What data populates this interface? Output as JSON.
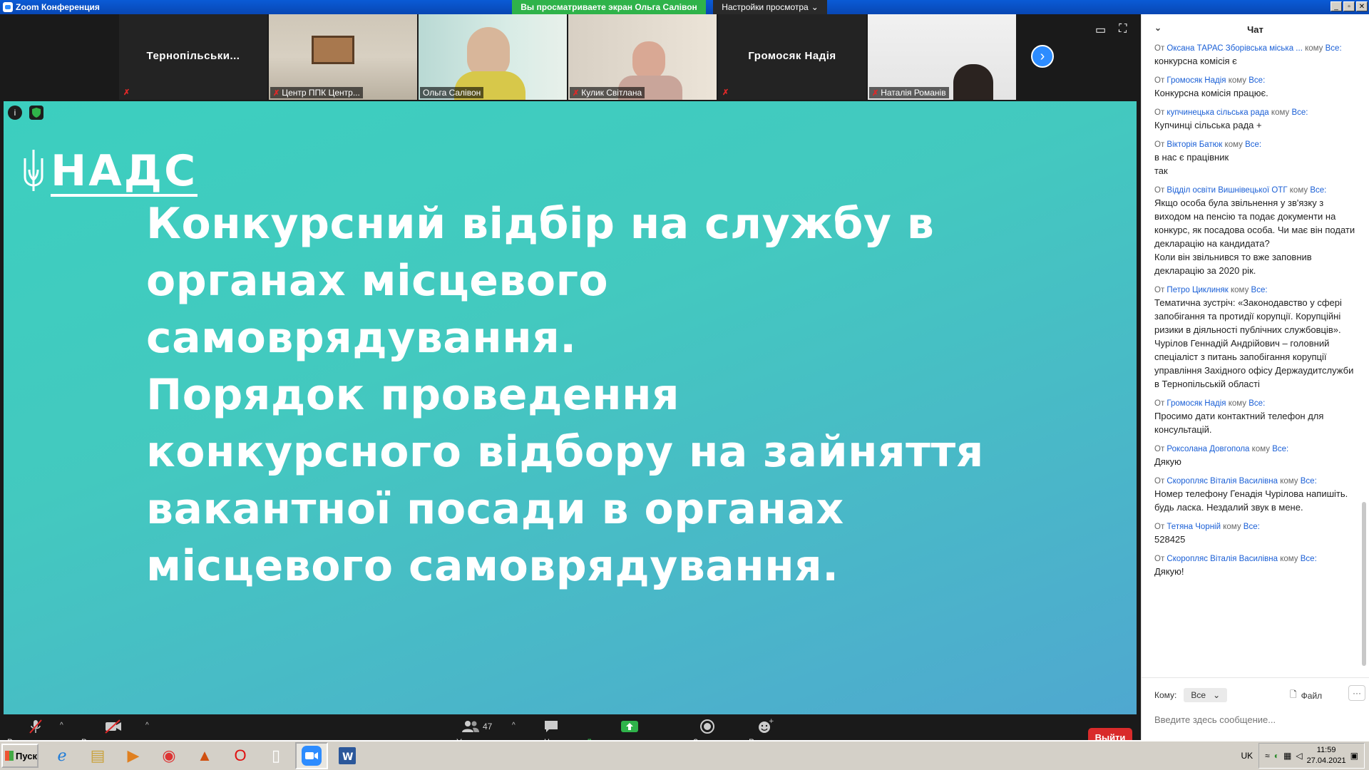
{
  "window": {
    "title": "Zoom Конференция",
    "banner": "Вы просматриваете экран Ольга Салівон",
    "view_options": "Настройки просмотра"
  },
  "participants": [
    {
      "name": "Тернопільськи...",
      "type": "name-only",
      "muted": true
    },
    {
      "name": "Центр ППК Центр...",
      "type": "video",
      "muted": true
    },
    {
      "name": "Ольга Салівон",
      "type": "video",
      "muted": false,
      "active": true
    },
    {
      "name": "Кулик Світлана",
      "type": "video",
      "muted": true
    },
    {
      "name": "Громосяк Надія",
      "type": "name-only",
      "muted": true
    },
    {
      "name": "Наталія Романів",
      "type": "video",
      "muted": true
    }
  ],
  "slide": {
    "logo_text": "НАДС",
    "title": "Конкурсний відбір на службу в органах місцевого самоврядування.\nПорядок проведення конкурсного відбору на зайняття  вакантної посади в органах місцевого самоврядування."
  },
  "toolbar": {
    "audio": "Включить звук",
    "video": "Включить видео",
    "participants": "Участники",
    "participants_count": "47",
    "chat": "Чат",
    "share": "Демонстрация экрана",
    "record": "Запись",
    "reactions": "Реакции",
    "leave": "Выйти"
  },
  "chat": {
    "title": "Чат",
    "messages": [
      {
        "prefix": "От",
        "from": "Оксана ТАРАС Зборівська міська ...",
        "to_word": "кому",
        "to": "Все:",
        "text": "конкурсна комісія є"
      },
      {
        "prefix": "От",
        "from": "Громосяк Надія",
        "to_word": "кому",
        "to": "Все:",
        "text": "Конкурсна комісія працює."
      },
      {
        "prefix": "От",
        "from": "купчинецька сільська рада",
        "to_word": "кому",
        "to": "Все:",
        "text": "Купчинці сільська рада +"
      },
      {
        "prefix": "От",
        "from": "Вікторія Батюк",
        "to_word": "кому",
        "to": "Все:",
        "text": "в нас є працівник\nтак"
      },
      {
        "prefix": "От",
        "from": "Відділ  освіти Вишнівецької ОТГ",
        "to_word": "кому",
        "to": "Все:",
        "text": "Якщо особа була звільнення у зв'язку з виходом на пенсію та подає документи на конкурс, як посадова особа. Чи має він подати декларацію на   кандидата?\nКоли він звільнився то вже заповнив декларацію за 2020 рік."
      },
      {
        "prefix": "От",
        "from": "Петро Циклиняк",
        "to_word": "кому",
        "to": "Все:",
        "text": "Тематична зустріч: «Законодавство у сфері запобігання та протидії корупції. Корупційні ризики в діяльності публічних службовців».   Чурілов Геннадій Андрійович – головний спеціаліст з питань запобігання корупції управління Західного офісу Держаудитслужби в Тернопільській області"
      },
      {
        "prefix": "От",
        "from": "Громосяк Надія",
        "to_word": "кому",
        "to": "Все:",
        "text": "Просимо дати контактний телефон для консультацій."
      },
      {
        "prefix": "От",
        "from": "Роксолана Довгопола",
        "to_word": "кому",
        "to": "Все:",
        "text": "Дякую"
      },
      {
        "prefix": "От",
        "from": "Скоропляс Віталія Василівна",
        "to_word": "кому",
        "to": "Все:",
        "text": "Номер телефону Генадія Чурілова напишіть. будь ласка. Нездалий звук в мене."
      },
      {
        "prefix": "От",
        "from": "Тетяна Чорній",
        "to_word": "кому",
        "to": "Все:",
        "text": "528425"
      },
      {
        "prefix": "От",
        "from": "Скоропляс Віталія Василівна",
        "to_word": "кому",
        "to": "Все:",
        "text": "Дякую!"
      }
    ],
    "to_label": "Кому:",
    "to_value": "Все",
    "file_label": "Файл",
    "more_label": "···",
    "input_placeholder": "Введите здесь сообщение..."
  },
  "taskbar": {
    "start": "Пуск",
    "lang": "UK",
    "time": "11:59",
    "date": "27.04.2021"
  },
  "colors": {
    "zoom_blue": "#2d8cff",
    "share_green": "#2fb34a",
    "leave_red": "#d92b2b",
    "slide_teal": "#3ccfbf",
    "slide_blue": "#4fa8d0"
  }
}
